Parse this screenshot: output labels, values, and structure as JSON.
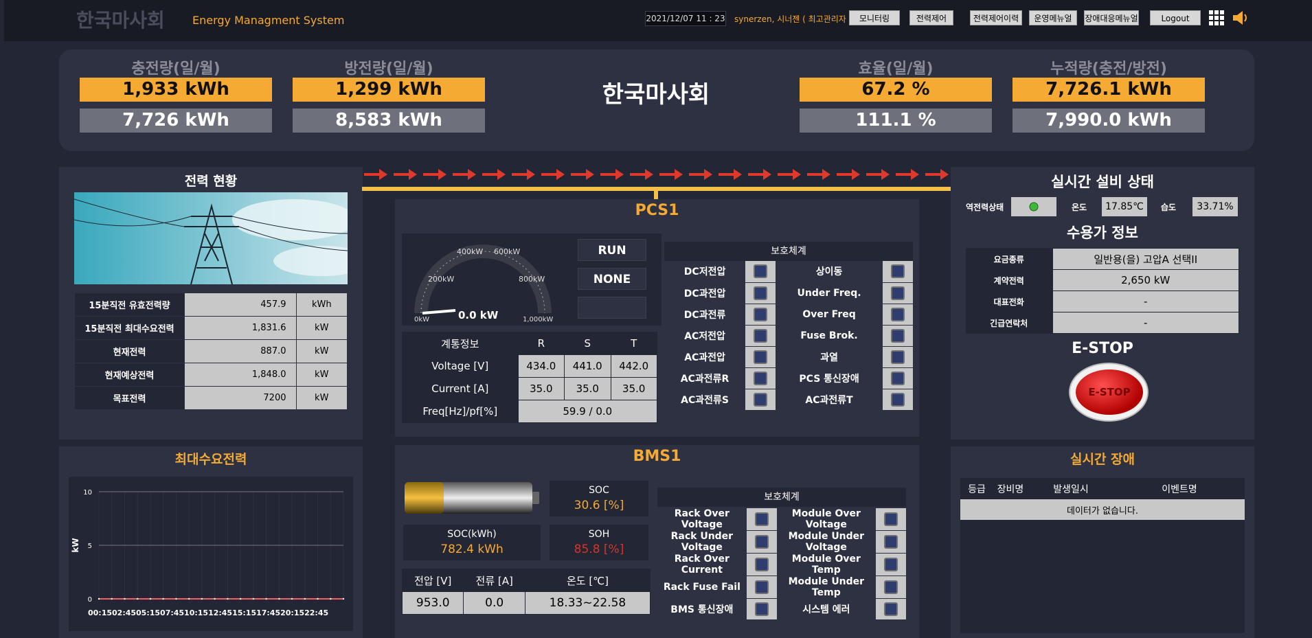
{
  "header": {
    "logo": "한국마사회",
    "subtitle": "Energy Managment System",
    "datetime": "2021/12/07 11 : 23",
    "user": "synerzen, 시너젠 ( 최고관리자 )",
    "nav": [
      "모니터링",
      "전력제어",
      "전력제어이력",
      "운영메뉴얼",
      "장애대응메뉴얼",
      "Logout"
    ]
  },
  "kpi": {
    "charge_title": "충전량(일/월)",
    "charge_day": "1,933 kWh",
    "charge_month": "7,726 kWh",
    "discharge_title": "방전량(일/월)",
    "discharge_day": "1,299 kWh",
    "discharge_month": "8,583 kWh",
    "site_name": "한국마사회",
    "eff_title": "효율(일/월)",
    "eff_day": "67.2 %",
    "eff_month": "111.1 %",
    "acc_title": "누적량(충전/방전)",
    "acc_charge": "7,726.1 kWh",
    "acc_discharge": "7,990.0 kWh"
  },
  "power": {
    "title": "전력 현황",
    "rows": [
      {
        "label": "15분직전 유효전력량",
        "value": "457.9",
        "unit": "kWh"
      },
      {
        "label": "15분직전 최대수요전력",
        "value": "1,831.6",
        "unit": "kW"
      },
      {
        "label": "현재전력",
        "value": "887.0",
        "unit": "kW"
      },
      {
        "label": "현재예상전력",
        "value": "1,848.0",
        "unit": "kW"
      },
      {
        "label": "목표전력",
        "value": "7200",
        "unit": "kW"
      }
    ]
  },
  "peak": {
    "title": "최대수요전력",
    "ylabel": "kW"
  },
  "chart_data": {
    "type": "line",
    "title": "최대수요전력",
    "ylabel": "kW",
    "ylim": [
      0,
      10
    ],
    "yticks": [
      0,
      5,
      10
    ],
    "x_label_row": "00:1502:4505:1507:4510:1512:4515:1517:4520:1522:45",
    "series": [
      {
        "values": [
          0,
          0,
          0,
          0,
          0,
          0,
          0,
          0,
          0,
          0,
          0,
          0,
          0,
          0,
          0,
          0,
          0,
          0,
          0,
          0
        ]
      }
    ],
    "grid": true
  },
  "pcs": {
    "title": "PCS1",
    "status1": "RUN",
    "status2": "NONE",
    "status3": "",
    "gauge": {
      "value": "0.0 kW",
      "labels": [
        "0kW",
        "200kW",
        "400kW",
        "600kW",
        "800kW",
        "1,000kW"
      ]
    },
    "grid": {
      "headers": [
        "계통정보",
        "R",
        "S",
        "T"
      ],
      "rows": [
        {
          "label": "Voltage [V]",
          "r": "434.0",
          "s": "441.0",
          "t": "442.0"
        },
        {
          "label": "Current [A]",
          "r": "35.0",
          "s": "35.0",
          "t": "35.0"
        }
      ],
      "freq_label": "Freq[Hz]/pf[%]",
      "freq_value": "59.9 / 0.0"
    },
    "prot_title": "보호체계",
    "prot": [
      [
        "DC저전압",
        "상이동"
      ],
      [
        "DC과전압",
        "Under Freq."
      ],
      [
        "DC과전류",
        "Over Freq"
      ],
      [
        "AC저전압",
        "Fuse Brok."
      ],
      [
        "AC과전압",
        "과열"
      ],
      [
        "AC과전류R",
        "PCS 통신장애"
      ],
      [
        "AC과전류S",
        "AC과전류T"
      ]
    ]
  },
  "bms": {
    "title": "BMS1",
    "soc_label": "SOC",
    "soc_value": "30.6 [%]",
    "soc_fraction": 0.306,
    "sock_label": "SOC(kWh)",
    "sock_value": "782.4 kWh",
    "soh_label": "SOH",
    "soh_value": "85.8 [%]",
    "hdr": [
      "전압 [V]",
      "전류 [A]",
      "온도 [℃]"
    ],
    "vals": [
      "953.0",
      "0.0",
      "18.33~22.58"
    ],
    "prot_title": "보호체계",
    "prot": [
      [
        "Rack Over Voltage",
        "Module Over Voltage"
      ],
      [
        "Rack Under Voltage",
        "Module Under Voltage"
      ],
      [
        "Rack Over Current",
        "Module Over Temp"
      ],
      [
        "Rack Fuse Fail",
        "Module Under Temp"
      ],
      [
        "BMS 통신장애",
        "시스템 에러"
      ]
    ]
  },
  "status": {
    "title": "실시간 설비 상태",
    "rev_label": "역전력상태",
    "temp_label": "온도",
    "temp_value": "17.85℃",
    "hum_label": "습도",
    "hum_value": "33.71%",
    "consumer_title": "수용가 정보",
    "consumer": [
      {
        "label": "요금종류",
        "value": "일반용(을) 고압A 선택II"
      },
      {
        "label": "계약전력",
        "value": "2,650 kW"
      },
      {
        "label": "대표전화",
        "value": "-"
      },
      {
        "label": "긴급연락처",
        "value": "-"
      }
    ],
    "estop_title": "E-STOP",
    "estop_button": "E-STOP"
  },
  "fault": {
    "title": "실시간 장애",
    "headers": [
      "등급",
      "장비명",
      "발생일시",
      "이벤트명"
    ],
    "empty": "데이터가 없습니다."
  },
  "colors": {
    "accent": "#f5aa33",
    "panel": "#2d3141",
    "bg": "#232634",
    "cell": "#c8c8c8",
    "arrow": "#e0392b"
  }
}
